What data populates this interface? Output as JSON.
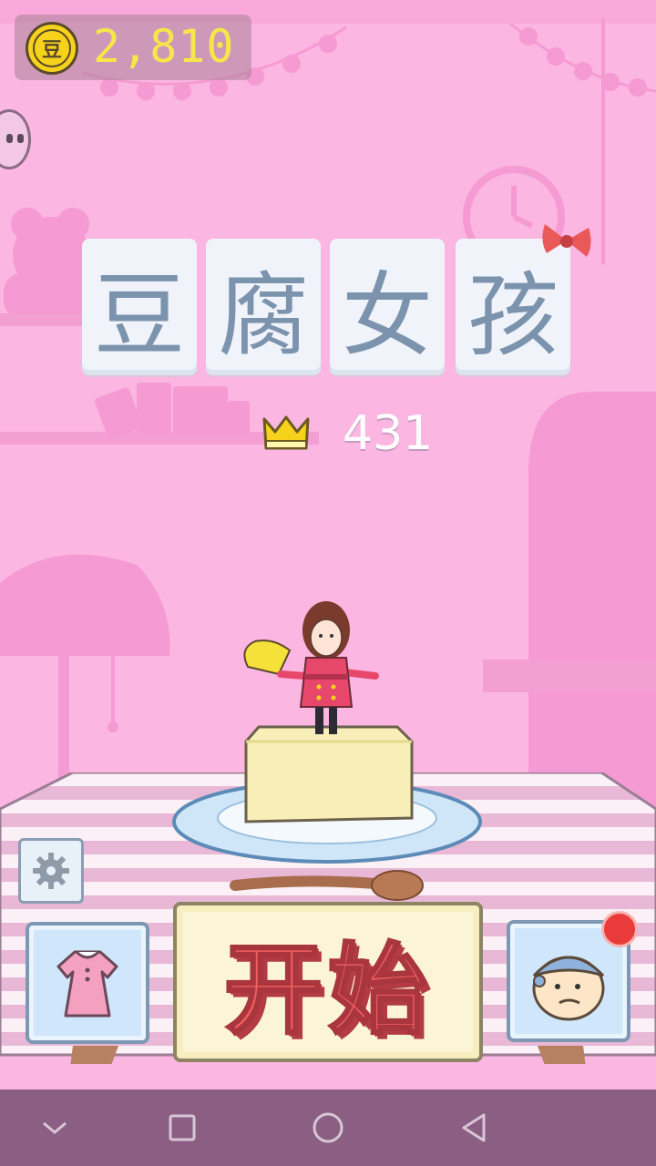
{
  "hud": {
    "coins": "2,810",
    "coin_symbol": "豆"
  },
  "title": {
    "chars": [
      "豆",
      "腐",
      "女",
      "孩"
    ]
  },
  "score": {
    "best": "431"
  },
  "buttons": {
    "start_label": "开始"
  },
  "colors": {
    "background": "#fbb6e2",
    "accent_red": "#f15f5f",
    "coin_gold": "#f6d21c",
    "tile_text": "#7c93ae",
    "nav_bar": "#8b5e84"
  },
  "icons": {
    "coin": "coin-icon",
    "crown": "crown-icon",
    "settings": "gear-icon",
    "wardrobe": "dress-icon",
    "chef": "chef-face-icon",
    "nav": [
      "chevron-down-icon",
      "square-icon",
      "circle-icon",
      "back-triangle-icon"
    ]
  }
}
